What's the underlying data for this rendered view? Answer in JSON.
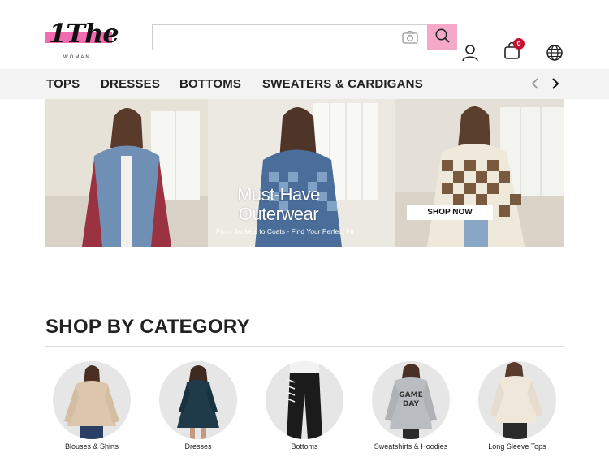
{
  "brand": {
    "logo_text": "1The",
    "logo_sub": "WOMAN"
  },
  "search": {
    "placeholder": "",
    "value": ""
  },
  "header": {
    "cart_count": "0"
  },
  "nav": {
    "items": [
      "TOPS",
      "DRESSES",
      "BOTTOMS",
      "SWEATERS & CARDIGANS"
    ]
  },
  "banner": {
    "headline_line1": "Must-Have",
    "headline_line2": "Outerwear",
    "subline": "From Jackets to Coats - Find Your Perfect Fit",
    "cta": "SHOP NOW"
  },
  "categories": {
    "title": "SHOP BY CATEGORY",
    "items": [
      {
        "label": "Blouses & Shirts"
      },
      {
        "label": "Dresses"
      },
      {
        "label": "Bottoms"
      },
      {
        "label": "Sweatshirts & Hoodies"
      },
      {
        "label": "Long Sleeve Tops"
      }
    ]
  },
  "colors": {
    "accent": "#f5a9c9",
    "logo_pink": "#f06bb0",
    "badge": "#c8102e",
    "nav_bg": "#f3f3f3"
  }
}
